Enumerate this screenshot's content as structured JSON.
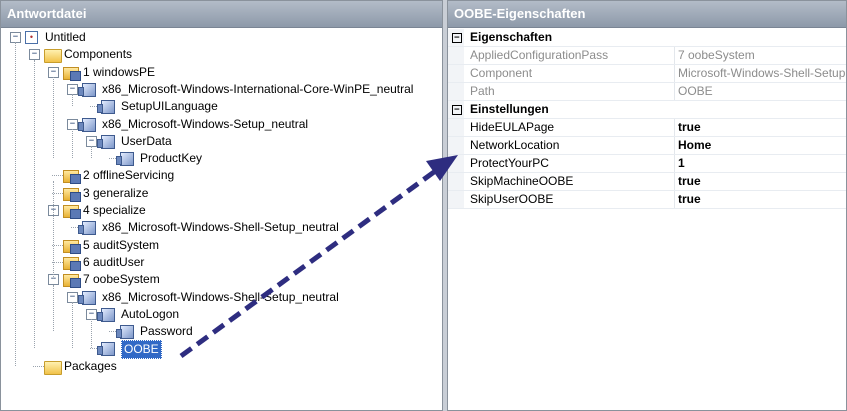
{
  "left_panel": {
    "title": "Antwortdatei",
    "tree": [
      {
        "label": "Untitled",
        "icon": "root-icon",
        "expander": "−"
      },
      {
        "label": "Components",
        "icon": "folder-icon",
        "expander": "−"
      },
      {
        "label": "1 windowsPE",
        "icon": "pass-icon",
        "expander": "−"
      },
      {
        "label": "x86_Microsoft-Windows-International-Core-WinPE_neutral",
        "icon": "component-icon",
        "expander": "−"
      },
      {
        "label": "SetupUILanguage",
        "icon": "component-icon"
      },
      {
        "label": "x86_Microsoft-Windows-Setup_neutral",
        "icon": "component-icon",
        "expander": "−"
      },
      {
        "label": "UserData",
        "icon": "component-icon",
        "expander": "−"
      },
      {
        "label": "ProductKey",
        "icon": "component-icon"
      },
      {
        "label": "2 offlineServicing",
        "icon": "pass-icon"
      },
      {
        "label": "3 generalize",
        "icon": "pass-icon"
      },
      {
        "label": "4 specialize",
        "icon": "pass-icon",
        "expander": "−"
      },
      {
        "label": "x86_Microsoft-Windows-Shell-Setup_neutral",
        "icon": "component-icon"
      },
      {
        "label": "5 auditSystem",
        "icon": "pass-icon"
      },
      {
        "label": "6 auditUser",
        "icon": "pass-icon"
      },
      {
        "label": "7 oobeSystem",
        "icon": "pass-icon",
        "expander": "−"
      },
      {
        "label": "x86_Microsoft-Windows-Shell-Setup_neutral",
        "icon": "component-icon",
        "expander": "−"
      },
      {
        "label": "AutoLogon",
        "icon": "component-icon",
        "expander": "−"
      },
      {
        "label": "Password",
        "icon": "component-icon"
      },
      {
        "label": "OOBE",
        "icon": "component-icon",
        "selected": true
      },
      {
        "label": "Packages",
        "icon": "folder-icon"
      }
    ]
  },
  "right_panel": {
    "title": "OOBE-Eigenschaften",
    "categories": [
      {
        "name": "Eigenschaften",
        "toggle": "−",
        "rows": [
          {
            "name": "AppliedConfigurationPass",
            "value": "7 oobeSystem",
            "readonly": true
          },
          {
            "name": "Component",
            "value": "Microsoft-Windows-Shell-Setup",
            "readonly": true
          },
          {
            "name": "Path",
            "value": "OOBE",
            "readonly": true
          }
        ]
      },
      {
        "name": "Einstellungen",
        "toggle": "−",
        "rows": [
          {
            "name": "HideEULAPage",
            "value": "true"
          },
          {
            "name": "NetworkLocation",
            "value": "Home"
          },
          {
            "name": "ProtectYourPC",
            "value": "1"
          },
          {
            "name": "SkipMachineOOBE",
            "value": "true"
          },
          {
            "name": "SkipUserOOBE",
            "value": "true"
          }
        ]
      }
    ]
  },
  "annotation": {
    "color": "#2e2d80"
  }
}
